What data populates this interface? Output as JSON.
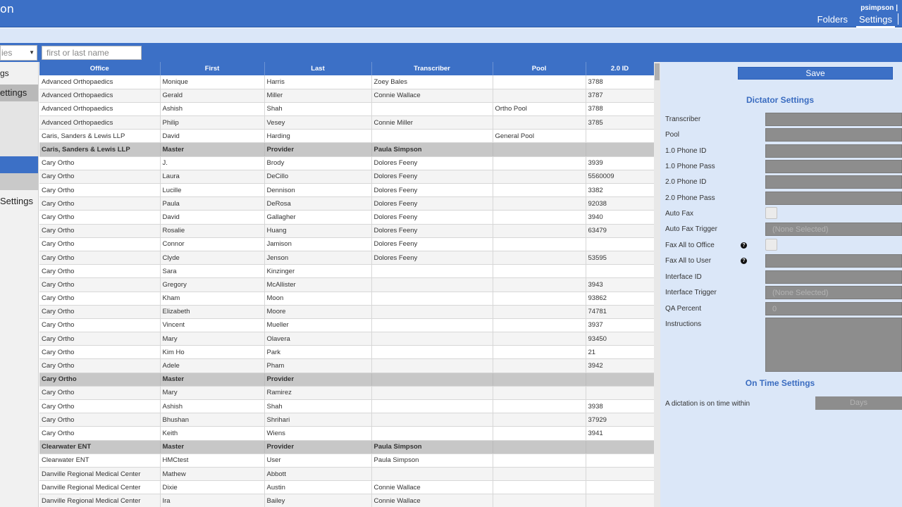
{
  "header": {
    "app_title_fragment": "on",
    "user": "psimpson |",
    "nav": [
      {
        "label": "Folders"
      },
      {
        "label": "Settings"
      }
    ]
  },
  "filter": {
    "type_select_value": "ies",
    "search_placeholder": "first or last name"
  },
  "sidebar": {
    "items": [
      {
        "label": "gs"
      },
      {
        "label": "ettings"
      },
      {
        "label": "Settings"
      }
    ]
  },
  "table": {
    "columns": [
      "Office",
      "First",
      "Last",
      "Transcriber",
      "Pool",
      "2.0 ID"
    ],
    "rows": [
      {
        "type": "row",
        "cells": [
          "Advanced Orthopaedics",
          "Monique",
          "Harris",
          "Zoey Bales",
          "",
          "3788"
        ]
      },
      {
        "type": "row",
        "cells": [
          "Advanced Orthopaedics",
          "Gerald",
          "Miller",
          "Connie Wallace",
          "",
          "3787"
        ]
      },
      {
        "type": "row",
        "cells": [
          "Advanced Orthopaedics",
          "Ashish",
          "Shah",
          "",
          "Ortho Pool",
          "3788"
        ]
      },
      {
        "type": "row",
        "cells": [
          "Advanced Orthopaedics",
          "Philip",
          "Vesey",
          "Connie Miller",
          "",
          "3785"
        ]
      },
      {
        "type": "row",
        "cells": [
          "Caris, Sanders & Lewis LLP",
          "David",
          "Harding",
          "",
          "General Pool",
          ""
        ]
      },
      {
        "type": "group",
        "cells": [
          "Caris, Sanders & Lewis LLP",
          "Master",
          "Provider",
          "Paula Simpson",
          "",
          ""
        ]
      },
      {
        "type": "row",
        "cells": [
          "Cary Ortho",
          "J.",
          "Brody",
          "Dolores Feeny",
          "",
          "3939"
        ]
      },
      {
        "type": "row",
        "cells": [
          "Cary Ortho",
          "Laura",
          "DeCillo",
          "Dolores Feeny",
          "",
          "5560009"
        ]
      },
      {
        "type": "row",
        "cells": [
          "Cary Ortho",
          "Lucille",
          "Dennison",
          "Dolores Feeny",
          "",
          "3382"
        ]
      },
      {
        "type": "row",
        "cells": [
          "Cary Ortho",
          "Paula",
          "DeRosa",
          "Dolores Feeny",
          "",
          "92038"
        ]
      },
      {
        "type": "row",
        "cells": [
          "Cary Ortho",
          "David",
          "Gallagher",
          "Dolores Feeny",
          "",
          "3940"
        ]
      },
      {
        "type": "row",
        "cells": [
          "Cary Ortho",
          "Rosalie",
          "Huang",
          "Dolores Feeny",
          "",
          "63479"
        ]
      },
      {
        "type": "row",
        "cells": [
          "Cary Ortho",
          "Connor",
          "Jamison",
          "Dolores Feeny",
          "",
          ""
        ]
      },
      {
        "type": "row",
        "cells": [
          "Cary Ortho",
          "Clyde",
          "Jenson",
          "Dolores Feeny",
          "",
          "53595"
        ]
      },
      {
        "type": "row",
        "cells": [
          "Cary Ortho",
          "Sara",
          "Kinzinger",
          "",
          "",
          ""
        ]
      },
      {
        "type": "row",
        "cells": [
          "Cary Ortho",
          "Gregory",
          "McAllister",
          "",
          "",
          "3943"
        ]
      },
      {
        "type": "row",
        "cells": [
          "Cary Ortho",
          "Kham",
          "Moon",
          "",
          "",
          "93862"
        ]
      },
      {
        "type": "row",
        "cells": [
          "Cary Ortho",
          "Elizabeth",
          "Moore",
          "",
          "",
          "74781"
        ]
      },
      {
        "type": "row",
        "cells": [
          "Cary Ortho",
          "Vincent",
          "Mueller",
          "",
          "",
          "3937"
        ]
      },
      {
        "type": "row",
        "cells": [
          "Cary Ortho",
          "Mary",
          "Olavera",
          "",
          "",
          "93450"
        ]
      },
      {
        "type": "row",
        "cells": [
          "Cary Ortho",
          "Kim Ho",
          "Park",
          "",
          "",
          "21"
        ]
      },
      {
        "type": "row",
        "cells": [
          "Cary Ortho",
          "Adele",
          "Pham",
          "",
          "",
          "3942"
        ]
      },
      {
        "type": "group",
        "cells": [
          "Cary Ortho",
          "Master",
          "Provider",
          "",
          "",
          ""
        ]
      },
      {
        "type": "row",
        "cells": [
          "Cary Ortho",
          "Mary",
          "Ramirez",
          "",
          "",
          ""
        ]
      },
      {
        "type": "row",
        "cells": [
          "Cary Ortho",
          "Ashish",
          "Shah",
          "",
          "",
          "3938"
        ]
      },
      {
        "type": "row",
        "cells": [
          "Cary Ortho",
          "Bhushan",
          "Shrihari",
          "",
          "",
          "37929"
        ]
      },
      {
        "type": "row",
        "cells": [
          "Cary Ortho",
          "Keith",
          "Wiens",
          "",
          "",
          "3941"
        ]
      },
      {
        "type": "group",
        "cells": [
          "Clearwater ENT",
          "Master",
          "Provider",
          "Paula Simpson",
          "",
          ""
        ]
      },
      {
        "type": "row",
        "cells": [
          "Clearwater ENT",
          "HMCtest",
          "User",
          "Paula Simpson",
          "",
          ""
        ]
      },
      {
        "type": "row",
        "cells": [
          "Danville Regional Medical Center",
          "Mathew",
          "Abbott",
          "",
          "",
          ""
        ]
      },
      {
        "type": "row",
        "cells": [
          "Danville Regional Medical Center",
          "Dixie",
          "Austin",
          "Connie Wallace",
          "",
          ""
        ]
      },
      {
        "type": "row",
        "cells": [
          "Danville Regional Medical Center",
          "Ira",
          "Bailey",
          "Connie Wallace",
          "",
          ""
        ]
      }
    ]
  },
  "panel": {
    "save_label": "Save",
    "dictator_title": "Dictator Settings",
    "fields": {
      "transcriber": "Transcriber",
      "pool": "Pool",
      "phone1_id": "1.0 Phone ID",
      "phone1_pass": "1.0 Phone Pass",
      "phone2_id": "2.0 Phone ID",
      "phone2_pass": "2.0 Phone Pass",
      "auto_fax": "Auto Fax",
      "auto_fax_trigger": "Auto Fax Trigger",
      "auto_fax_trigger_value": "(None Selected)",
      "fax_all_office": "Fax All to Office",
      "fax_all_user": "Fax All to User",
      "interface_id": "Interface ID",
      "interface_trigger": "Interface Trigger",
      "interface_trigger_value": "(None Selected)",
      "qa_percent": "QA Percent",
      "qa_percent_value": "0",
      "instructions": "Instructions"
    },
    "help_glyph": "?",
    "ontime_title": "On Time Settings",
    "ontime_label": "A dictation is on time within",
    "days_placeholder": "Days"
  },
  "colors": {
    "accent": "#3c70c6",
    "panel_bg": "#dbe7f8",
    "group_row": "#c7c7c7",
    "field_fill": "#8d8d8d"
  }
}
